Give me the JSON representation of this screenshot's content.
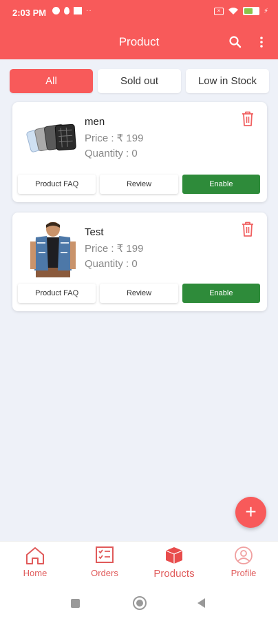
{
  "status_bar": {
    "time": "2:03 PM",
    "more": "··",
    "battery_level": 0.6,
    "battery_color": "#8bc34a"
  },
  "app_bar": {
    "title": "Product",
    "icons": [
      "search-icon",
      "more-vertical-icon"
    ],
    "color": "#f85a5a"
  },
  "filters": [
    {
      "label": "All",
      "active": true
    },
    {
      "label": "Sold out",
      "active": false
    },
    {
      "label": "Low in Stock",
      "active": false
    }
  ],
  "products": [
    {
      "name": "men",
      "price": "Price : ₹ 199",
      "quantity": "Quantity : 0",
      "image": "shirts-image",
      "buttons": {
        "faq": "Product FAQ",
        "review": "Review",
        "enable": "Enable"
      }
    },
    {
      "name": "Test",
      "price": "Price : ₹ 199",
      "quantity": "Quantity : 0",
      "image": "denim-vest-image",
      "buttons": {
        "faq": "Product FAQ",
        "review": "Review",
        "enable": "Enable"
      }
    }
  ],
  "fab": {
    "label": "+"
  },
  "bottom_nav": {
    "home": "Home",
    "orders": "Orders",
    "products": "Products",
    "profile": "Profile",
    "active": "Products"
  },
  "colors": {
    "accent": "#f85a5a",
    "enable": "#2e8b3a",
    "background": "#eef1f8"
  }
}
